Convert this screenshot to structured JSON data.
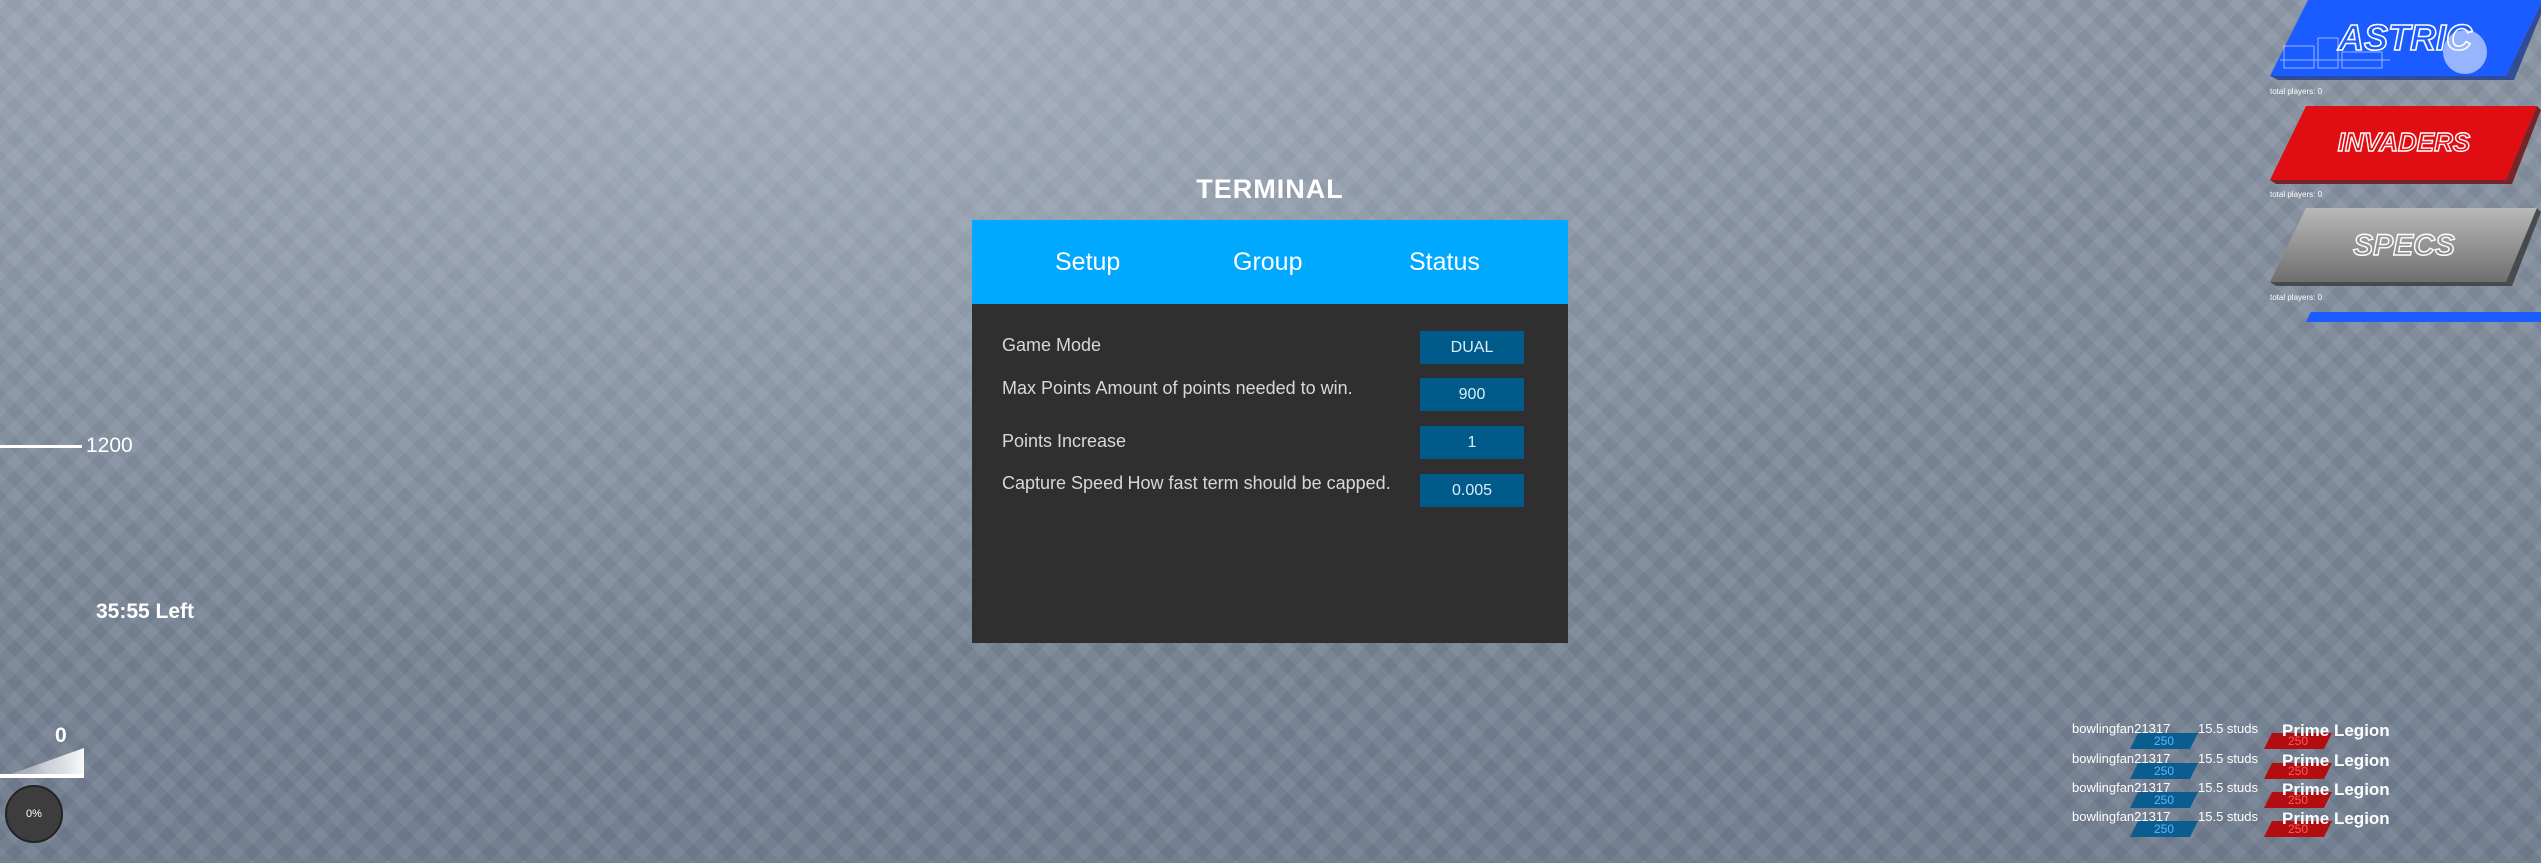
{
  "terminal": {
    "title": "TERMINAL",
    "tabs": [
      "Setup",
      "Group",
      "Status"
    ],
    "settings": [
      {
        "label": "Game Mode",
        "description": "",
        "value": "DUAL"
      },
      {
        "label": "Max Points",
        "description": "Amount of points needed to win.",
        "value": "900"
      },
      {
        "label": "Points Increase",
        "description": "",
        "value": "1"
      },
      {
        "label": "Capture Speed",
        "description": "How fast term should be capped.",
        "value": "0.005"
      }
    ]
  },
  "hud": {
    "meter_value": "1200",
    "time_left": "35:55 Left",
    "count": "0",
    "progress_label": "0%",
    "progress": 0
  },
  "teams": [
    {
      "name": "ASTRIC",
      "players_label": "total players: 0",
      "color": "#1a5cff"
    },
    {
      "name": "INVADERS",
      "players_label": "total players: 0",
      "color": "#e00d12"
    },
    {
      "name": "SPECS",
      "players_label": "total players: 0",
      "color": "#8c8c8c"
    }
  ],
  "players": [
    {
      "name": "bowlingfan21317",
      "badge": "250",
      "distance": "15.5 studs",
      "team": "Prime Legion",
      "team_badge": "250"
    },
    {
      "name": "bowlingfan21317",
      "badge": "250",
      "distance": "15.5 studs",
      "team": "Prime Legion",
      "team_badge": "250"
    },
    {
      "name": "bowlingfan21317",
      "badge": "250",
      "distance": "15.5 studs",
      "team": "Prime Legion",
      "team_badge": "250"
    },
    {
      "name": "bowlingfan21317",
      "badge": "250",
      "distance": "15.5 studs",
      "team": "Prime Legion",
      "team_badge": "250"
    }
  ]
}
